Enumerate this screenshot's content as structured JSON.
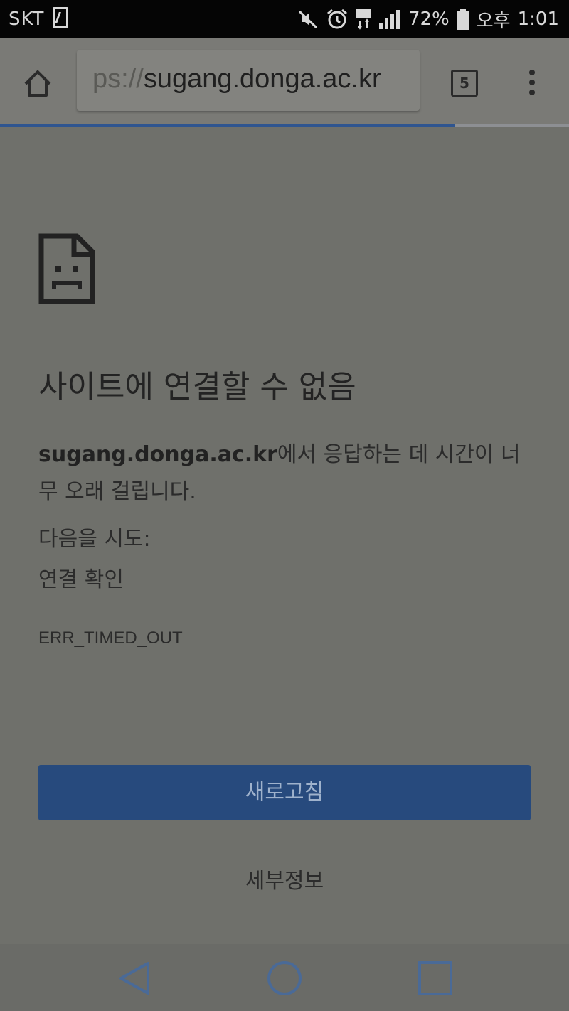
{
  "status_bar": {
    "carrier": "SKT",
    "battery": "72%",
    "ampm": "오후",
    "time": "1:01",
    "icons": [
      "sim-icon",
      "mute-icon",
      "alarm-icon",
      "lte-icon",
      "signal-icon",
      "battery-icon"
    ]
  },
  "browser": {
    "url": "ps://sugang.donga.ac.kr",
    "url_scheme_fragment": "ps://",
    "url_host": "sugang.donga.ac.kr",
    "tab_count": "5",
    "load_progress": 0.8,
    "icons": [
      "home-icon",
      "tabs-icon",
      "more-menu-icon"
    ]
  },
  "error_page": {
    "title": "사이트에 연결할 수 없음",
    "host": "sugang.donga.ac.kr",
    "message_suffix": "에서 응답하는 데 시간이 너무 오래 걸립니다.",
    "try_heading": "다음을 시도:",
    "try_item": "연결 확인",
    "error_code": "ERR_TIMED_OUT",
    "reload_label": "새로고침",
    "details_label": "세부정보",
    "icon": "sad-page-icon"
  },
  "navigation": {
    "icons": [
      "back-icon",
      "home-circle-icon",
      "recents-icon"
    ]
  },
  "colors": {
    "primary_button": "#274a7d",
    "progress": "#2f5590",
    "page_bg": "#6f706b",
    "status_bar": "#050505"
  }
}
